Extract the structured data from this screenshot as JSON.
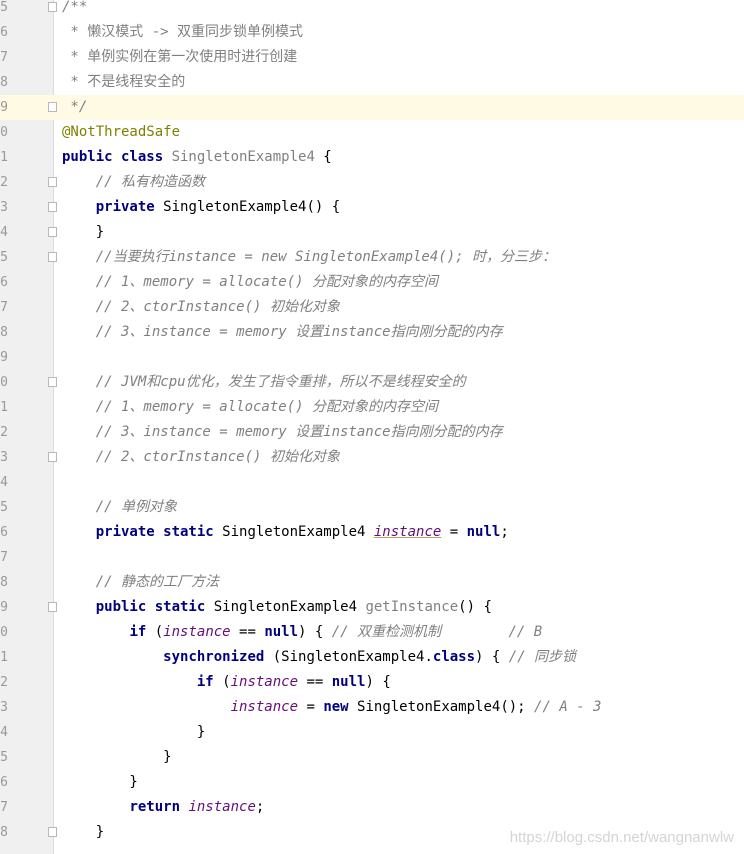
{
  "editor": {
    "lines": [
      {
        "no": "5",
        "fold": true,
        "current": false,
        "segs": [
          {
            "t": "/**",
            "c": "cm"
          }
        ]
      },
      {
        "no": "6",
        "fold": false,
        "current": false,
        "segs": [
          {
            "t": " * 懒汉模式 -> 双重同步锁单例模式",
            "c": "cm-doc"
          }
        ]
      },
      {
        "no": "7",
        "fold": false,
        "current": false,
        "segs": [
          {
            "t": " * 单例实例在第一次使用时进行创建",
            "c": "cm-doc"
          }
        ]
      },
      {
        "no": "8",
        "fold": false,
        "current": false,
        "segs": [
          {
            "t": " * 不是线程安全的",
            "c": "cm-doc"
          }
        ]
      },
      {
        "no": "9",
        "fold": true,
        "current": true,
        "segs": [
          {
            "t": " */",
            "c": "cm"
          }
        ]
      },
      {
        "no": "0",
        "fold": false,
        "current": false,
        "segs": [
          {
            "t": "@NotThreadSafe",
            "c": "an"
          }
        ]
      },
      {
        "no": "1",
        "fold": false,
        "current": false,
        "segs": [
          {
            "t": "public class ",
            "c": "kw"
          },
          {
            "t": "SingletonExample4",
            "c": "cls-gray"
          },
          {
            "t": " {",
            "c": "plain"
          }
        ]
      },
      {
        "no": "2",
        "fold": true,
        "current": false,
        "segs": [
          {
            "t": "    ",
            "c": "plain"
          },
          {
            "t": "// 私有构造函数",
            "c": "cm"
          }
        ]
      },
      {
        "no": "3",
        "fold": true,
        "current": false,
        "segs": [
          {
            "t": "    ",
            "c": "plain"
          },
          {
            "t": "private ",
            "c": "kw"
          },
          {
            "t": "SingletonExample4() {",
            "c": "plain"
          }
        ]
      },
      {
        "no": "4",
        "fold": true,
        "current": false,
        "segs": [
          {
            "t": "    }",
            "c": "plain"
          }
        ]
      },
      {
        "no": "5",
        "fold": true,
        "current": false,
        "segs": [
          {
            "t": "    ",
            "c": "plain"
          },
          {
            "t": "//当要执行instance = new SingletonExample4(); 时，分三步：",
            "c": "cm"
          }
        ]
      },
      {
        "no": "6",
        "fold": false,
        "current": false,
        "segs": [
          {
            "t": "    ",
            "c": "plain"
          },
          {
            "t": "// 1、memory = allocate() 分配对象的内存空间",
            "c": "cm"
          }
        ]
      },
      {
        "no": "7",
        "fold": false,
        "current": false,
        "segs": [
          {
            "t": "    ",
            "c": "plain"
          },
          {
            "t": "// 2、ctorInstance() 初始化对象",
            "c": "cm"
          }
        ]
      },
      {
        "no": "8",
        "fold": false,
        "current": false,
        "segs": [
          {
            "t": "    ",
            "c": "plain"
          },
          {
            "t": "// 3、instance = memory 设置instance指向刚分配的内存",
            "c": "cm"
          }
        ]
      },
      {
        "no": "9",
        "fold": false,
        "current": false,
        "segs": []
      },
      {
        "no": "0",
        "fold": true,
        "current": false,
        "segs": [
          {
            "t": "    ",
            "c": "plain"
          },
          {
            "t": "// JVM和cpu优化，发生了指令重排，所以不是线程安全的",
            "c": "cm"
          }
        ]
      },
      {
        "no": "1",
        "fold": false,
        "current": false,
        "segs": [
          {
            "t": "    ",
            "c": "plain"
          },
          {
            "t": "// 1、memory = allocate() 分配对象的内存空间",
            "c": "cm"
          }
        ]
      },
      {
        "no": "2",
        "fold": false,
        "current": false,
        "segs": [
          {
            "t": "    ",
            "c": "plain"
          },
          {
            "t": "// 3、instance = memory 设置instance指向刚分配的内存",
            "c": "cm"
          }
        ]
      },
      {
        "no": "3",
        "fold": true,
        "current": false,
        "segs": [
          {
            "t": "    ",
            "c": "plain"
          },
          {
            "t": "// 2、ctorInstance() 初始化对象",
            "c": "cm"
          }
        ]
      },
      {
        "no": "4",
        "fold": false,
        "current": false,
        "segs": []
      },
      {
        "no": "5",
        "fold": false,
        "current": false,
        "segs": [
          {
            "t": "    ",
            "c": "plain"
          },
          {
            "t": "// 单例对象",
            "c": "cm"
          }
        ]
      },
      {
        "no": "6",
        "fold": false,
        "current": false,
        "segs": [
          {
            "t": "    ",
            "c": "plain"
          },
          {
            "t": "private static ",
            "c": "kw"
          },
          {
            "t": "SingletonExample4 ",
            "c": "plain"
          },
          {
            "t": "instance",
            "c": "field field-ul"
          },
          {
            "t": " = ",
            "c": "plain"
          },
          {
            "t": "null",
            "c": "kw"
          },
          {
            "t": ";",
            "c": "plain"
          }
        ]
      },
      {
        "no": "7",
        "fold": false,
        "current": false,
        "segs": []
      },
      {
        "no": "8",
        "fold": false,
        "current": false,
        "segs": [
          {
            "t": "    ",
            "c": "plain"
          },
          {
            "t": "// 静态的工厂方法",
            "c": "cm"
          }
        ]
      },
      {
        "no": "9",
        "fold": true,
        "current": false,
        "segs": [
          {
            "t": "    ",
            "c": "plain"
          },
          {
            "t": "public static ",
            "c": "kw"
          },
          {
            "t": "SingletonExample4 ",
            "c": "plain"
          },
          {
            "t": "getInstance",
            "c": "cls-gray"
          },
          {
            "t": "() {",
            "c": "plain"
          }
        ]
      },
      {
        "no": "0",
        "fold": false,
        "current": false,
        "segs": [
          {
            "t": "        ",
            "c": "plain"
          },
          {
            "t": "if ",
            "c": "kw"
          },
          {
            "t": "(",
            "c": "plain"
          },
          {
            "t": "instance",
            "c": "field"
          },
          {
            "t": " == ",
            "c": "plain"
          },
          {
            "t": "null",
            "c": "kw"
          },
          {
            "t": ") { ",
            "c": "plain"
          },
          {
            "t": "// 双重检测机制        // B",
            "c": "cm"
          }
        ]
      },
      {
        "no": "1",
        "fold": false,
        "current": false,
        "segs": [
          {
            "t": "            ",
            "c": "plain"
          },
          {
            "t": "synchronized ",
            "c": "kw"
          },
          {
            "t": "(SingletonExample4.",
            "c": "plain"
          },
          {
            "t": "class",
            "c": "kw"
          },
          {
            "t": ") { ",
            "c": "plain"
          },
          {
            "t": "// 同步锁",
            "c": "cm"
          }
        ]
      },
      {
        "no": "2",
        "fold": false,
        "current": false,
        "segs": [
          {
            "t": "                ",
            "c": "plain"
          },
          {
            "t": "if ",
            "c": "kw"
          },
          {
            "t": "(",
            "c": "plain"
          },
          {
            "t": "instance",
            "c": "field"
          },
          {
            "t": " == ",
            "c": "plain"
          },
          {
            "t": "null",
            "c": "kw"
          },
          {
            "t": ") {",
            "c": "plain"
          }
        ]
      },
      {
        "no": "3",
        "fold": false,
        "current": false,
        "segs": [
          {
            "t": "                    ",
            "c": "plain"
          },
          {
            "t": "instance",
            "c": "field"
          },
          {
            "t": " = ",
            "c": "plain"
          },
          {
            "t": "new ",
            "c": "kw"
          },
          {
            "t": "SingletonExample4(); ",
            "c": "plain"
          },
          {
            "t": "// A - 3",
            "c": "cm"
          }
        ]
      },
      {
        "no": "4",
        "fold": false,
        "current": false,
        "segs": [
          {
            "t": "                }",
            "c": "plain"
          }
        ]
      },
      {
        "no": "5",
        "fold": false,
        "current": false,
        "segs": [
          {
            "t": "            }",
            "c": "plain"
          }
        ]
      },
      {
        "no": "6",
        "fold": false,
        "current": false,
        "segs": [
          {
            "t": "        }",
            "c": "plain"
          }
        ]
      },
      {
        "no": "7",
        "fold": false,
        "current": false,
        "segs": [
          {
            "t": "        ",
            "c": "plain"
          },
          {
            "t": "return ",
            "c": "kw"
          },
          {
            "t": "instance",
            "c": "field"
          },
          {
            "t": ";",
            "c": "plain"
          }
        ]
      },
      {
        "no": "8",
        "fold": true,
        "current": false,
        "segs": [
          {
            "t": "    }",
            "c": "plain"
          }
        ]
      }
    ]
  },
  "watermark": "https://blog.csdn.net/wangnanwlw"
}
